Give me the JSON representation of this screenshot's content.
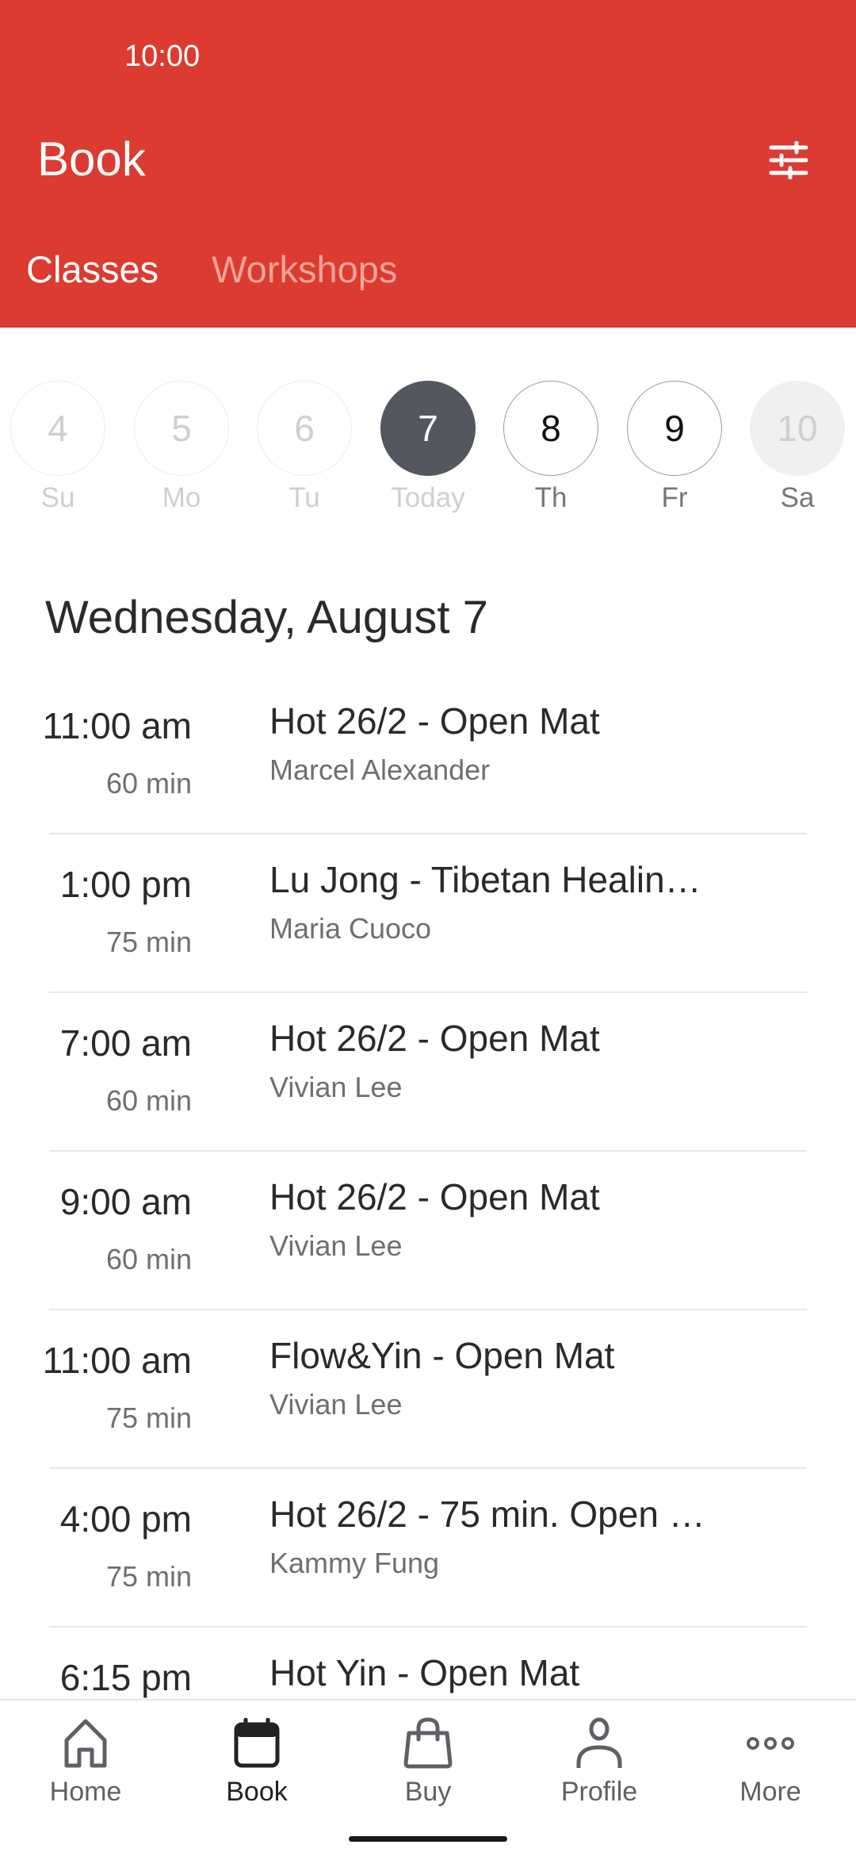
{
  "status_bar": {
    "time": "10:00"
  },
  "header": {
    "title": "Book",
    "filter_icon": "sliders-icon",
    "tabs": [
      {
        "label": "Classes",
        "active": true
      },
      {
        "label": "Workshops",
        "active": false
      }
    ],
    "color": "#db3b31"
  },
  "week": [
    {
      "num": "4",
      "label": "Su",
      "state": "past"
    },
    {
      "num": "5",
      "label": "Mo",
      "state": "past"
    },
    {
      "num": "6",
      "label": "Tu",
      "state": "past"
    },
    {
      "num": "7",
      "label": "Today",
      "state": "today"
    },
    {
      "num": "8",
      "label": "Th",
      "state": "future"
    },
    {
      "num": "9",
      "label": "Fr",
      "state": "future"
    },
    {
      "num": "10",
      "label": "Sa",
      "state": "unavailable"
    }
  ],
  "date_heading": "Wednesday, August 7",
  "classes": [
    {
      "time": "11:00 am",
      "duration": "60 min",
      "name": "Hot 26/2 - Open Mat",
      "instructor": "Marcel Alexander"
    },
    {
      "time": "1:00 pm",
      "duration": "75 min",
      "name": "Lu Jong - Tibetan Healin…",
      "instructor": "Maria Cuoco"
    },
    {
      "time": "7:00 am",
      "duration": "60 min",
      "name": "Hot 26/2 - Open Mat",
      "instructor": "Vivian Lee"
    },
    {
      "time": "9:00 am",
      "duration": "60 min",
      "name": "Hot 26/2 - Open Mat",
      "instructor": "Vivian Lee"
    },
    {
      "time": "11:00 am",
      "duration": "75 min",
      "name": "Flow&Yin - Open Mat",
      "instructor": "Vivian Lee"
    },
    {
      "time": "4:00 pm",
      "duration": "75 min",
      "name": "Hot 26/2 - 75 min. Open …",
      "instructor": "Kammy Fung"
    },
    {
      "time": "6:15 pm",
      "duration": "",
      "name": "Hot Yin - Open Mat",
      "instructor": ""
    }
  ],
  "bottom_nav": [
    {
      "label": "Home",
      "icon": "home-icon",
      "active": false
    },
    {
      "label": "Book",
      "icon": "calendar-icon",
      "active": true
    },
    {
      "label": "Buy",
      "icon": "shopping-bag-icon",
      "active": false
    },
    {
      "label": "Profile",
      "icon": "person-icon",
      "active": false
    },
    {
      "label": "More",
      "icon": "more-dots-icon",
      "active": false
    }
  ]
}
